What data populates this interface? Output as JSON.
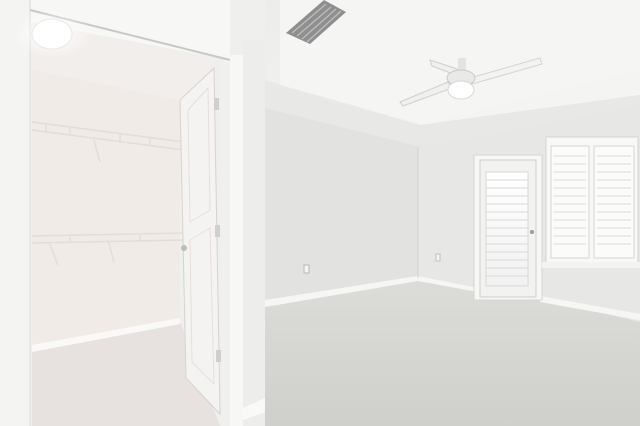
{
  "scene": {
    "kind": "photo",
    "subject": "empty-room-with-walk-in-closet",
    "colors": {
      "wall": "#e6e6e4",
      "wall_shade": "#d9d9d7",
      "ceiling": "#f1f1ef",
      "carpet": "#d6d6d3",
      "closet_wall": "#f3eeec",
      "closet_carpet": "#e4e0de",
      "trim": "#f7f7f5",
      "door": "#f4f2f0"
    }
  }
}
